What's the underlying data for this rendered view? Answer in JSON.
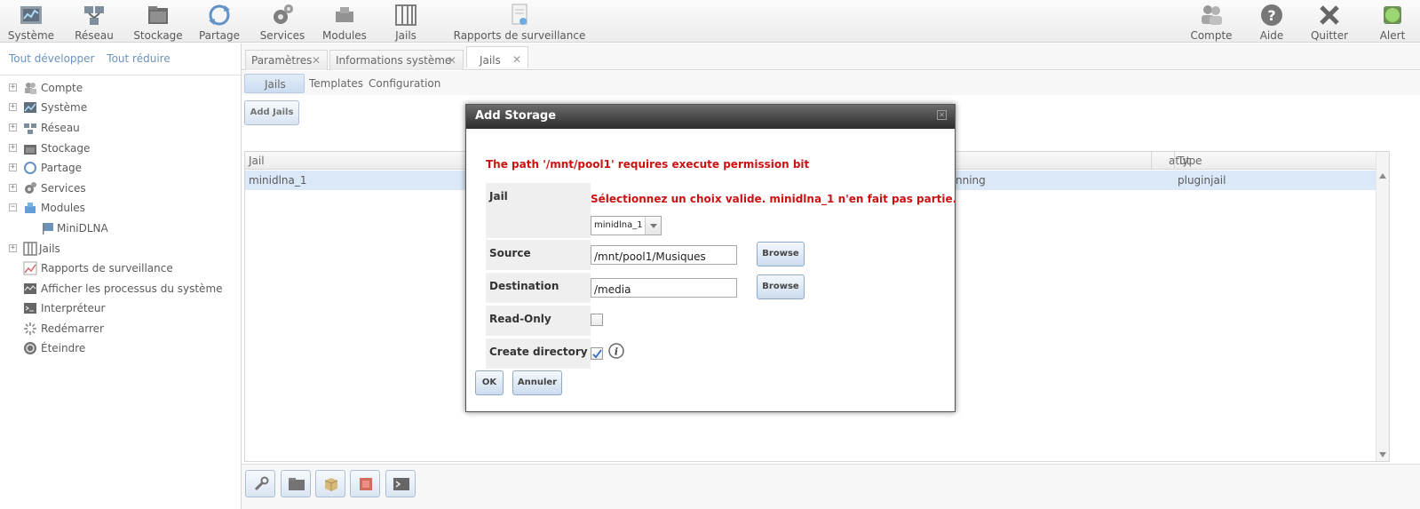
{
  "toolbar": {
    "left": [
      {
        "label": "Système",
        "icon": "system-icon"
      },
      {
        "label": "Réseau",
        "icon": "network-icon"
      },
      {
        "label": "Stockage",
        "icon": "storage-icon"
      },
      {
        "label": "Partage",
        "icon": "sharing-icon"
      },
      {
        "label": "Services",
        "icon": "services-icon"
      },
      {
        "label": "Modules",
        "icon": "modules-icon"
      },
      {
        "label": "Jails",
        "icon": "jails-icon"
      },
      {
        "label": "Rapports de surveillance",
        "icon": "reports-icon"
      }
    ],
    "right": [
      {
        "label": "Compte",
        "icon": "account-icon"
      },
      {
        "label": "Aide",
        "icon": "help-icon"
      },
      {
        "label": "Quitter",
        "icon": "logout-icon"
      },
      {
        "label": "Alert",
        "icon": "alert-icon"
      }
    ]
  },
  "sidebar": {
    "expand_all": "Tout développer",
    "collapse_all": "Tout réduire",
    "items": [
      {
        "label": "Compte",
        "expander": "+"
      },
      {
        "label": "Système",
        "expander": "+"
      },
      {
        "label": "Réseau",
        "expander": "+"
      },
      {
        "label": "Stockage",
        "expander": "+"
      },
      {
        "label": "Partage",
        "expander": "+"
      },
      {
        "label": "Services",
        "expander": "+"
      },
      {
        "label": "Modules",
        "expander": "−"
      },
      {
        "label": "MiniDLNA",
        "expander": ""
      },
      {
        "label": "Jails",
        "expander": "+"
      },
      {
        "label": "Rapports de surveillance",
        "expander": ""
      },
      {
        "label": "Afficher les processus du système",
        "expander": ""
      },
      {
        "label": "Interpréteur",
        "expander": ""
      },
      {
        "label": "Redémarrer",
        "expander": ""
      },
      {
        "label": "Éteindre",
        "expander": ""
      }
    ]
  },
  "tabs": [
    {
      "label": "Paramètres"
    },
    {
      "label": "Informations système"
    },
    {
      "label": "Jails"
    }
  ],
  "subtabs": [
    {
      "label": "Jails"
    },
    {
      "label": "Templates"
    },
    {
      "label": "Configuration"
    }
  ],
  "add_jails_label": "Add Jails",
  "grid": {
    "columns": [
      "Jail",
      "atut",
      "Type"
    ],
    "row": {
      "jail": "minidlna_1",
      "status": "nning",
      "type": "pluginjail"
    }
  },
  "dialog": {
    "title": "Add Storage",
    "error_top": "The path '/mnt/pool1' requires execute permission bit",
    "jail_label": "Jail",
    "jail_error": "Sélectionnez un choix valide. minidlna_1 n'en fait pas partie.",
    "jail_value": "minidlna_1",
    "source_label": "Source",
    "source_value": "/mnt/pool1/Musiques",
    "destination_label": "Destination",
    "destination_value": "/media",
    "browse_label": "Browse",
    "readonly_label": "Read-Only",
    "create_dir_label": "Create directory",
    "ok_label": "OK",
    "cancel_label": "Annuler"
  },
  "colors": {
    "accent": "#3a6ea5",
    "error": "#cc1111",
    "selected_row": "#cfe0f4"
  }
}
